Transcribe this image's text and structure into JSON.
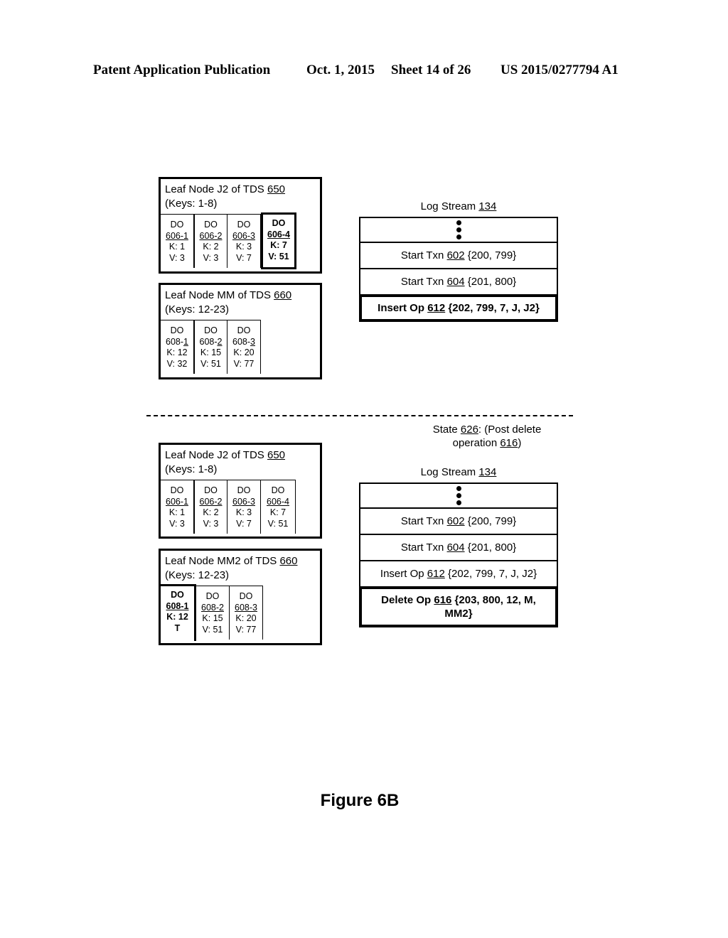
{
  "header": {
    "publication": "Patent Application Publication",
    "date": "Oct. 1, 2015",
    "sheet": "Sheet 14 of 26",
    "number": "US 2015/0277794 A1"
  },
  "top": {
    "leaf_j2": {
      "title_pre": "Leaf Node J2 of TDS ",
      "title_ref": "650",
      "keys": "(Keys: 1-8)",
      "cells": [
        {
          "l1": "DO",
          "ref": "606-1",
          "k": "K: 1",
          "v": "V: 3"
        },
        {
          "l1": "DO",
          "ref": "606-2",
          "k": "K: 2",
          "v": "V: 3"
        },
        {
          "l1": "DO",
          "ref": "606-3",
          "k": "K: 3",
          "v": "V: 7"
        },
        {
          "l1": "DO",
          "ref": "606-4",
          "k": "K: 7",
          "v": "V: 51",
          "highlight": true
        }
      ]
    },
    "leaf_mm": {
      "title_pre": "Leaf Node MM of TDS ",
      "title_ref": "660",
      "keys": "(Keys: 12-23)",
      "cells": [
        {
          "l1": "DO",
          "ref_pre": "608-",
          "ref_u": "1",
          "k": "K: 12",
          "v": "V: 32"
        },
        {
          "l1": "DO",
          "ref_pre": "608-",
          "ref_u": "2",
          "k": "K: 15",
          "v": "V: 51"
        },
        {
          "l1": "DO",
          "ref_pre": "608-",
          "ref_u": "3",
          "k": "K: 20",
          "v": "V: 77"
        }
      ]
    },
    "log": {
      "title_pre": "Log Stream ",
      "title_ref": "134",
      "rows": [
        {
          "pre": "Start Txn ",
          "ref": "602",
          "post": " {200, 799}"
        },
        {
          "pre": "Start Txn ",
          "ref": "604",
          "post": " {201, 800}"
        },
        {
          "pre": "Insert Op ",
          "ref": "612",
          "post": " {202, 799, 7, J, J2}",
          "highlight": true
        }
      ]
    }
  },
  "state": {
    "pre": "State ",
    "ref": "626",
    "mid": ": (Post delete operation ",
    "ref2": "616",
    "post": ")"
  },
  "bottom": {
    "leaf_j2": {
      "title_pre": "Leaf Node J2 of TDS ",
      "title_ref": "650",
      "keys": "(Keys: 1-8)",
      "cells": [
        {
          "l1": "DO",
          "ref": "606-1",
          "k": "K: 1",
          "v": "V: 3"
        },
        {
          "l1": "DO",
          "ref": "606-2",
          "k": "K: 2",
          "v": "V: 3"
        },
        {
          "l1": "DO",
          "ref": "606-3",
          "k": "K: 3",
          "v": "V: 7"
        },
        {
          "l1": "DO",
          "ref": "606-4",
          "k": "K: 7",
          "v": "V: 51"
        }
      ]
    },
    "leaf_mm2": {
      "title_pre": "Leaf Node MM2 of TDS ",
      "title_ref": "660",
      "keys": "(Keys: 12-23)",
      "cells": [
        {
          "l1": "DO",
          "ref": "608-1",
          "k": "K: 12",
          "v": "T",
          "highlight": true
        },
        {
          "l1": "DO",
          "ref": "608-2",
          "k": "K: 15",
          "v": "V: 51"
        },
        {
          "l1": "DO",
          "ref": "608-3",
          "k": "K: 20",
          "v": "V: 77"
        }
      ]
    },
    "log": {
      "title_pre": "Log Stream ",
      "title_ref": "134",
      "rows": [
        {
          "pre": "Start Txn ",
          "ref": "602",
          "post": " {200, 799}"
        },
        {
          "pre": "Start Txn ",
          "ref": "604",
          "post": " {201, 800}"
        },
        {
          "pre": "Insert Op ",
          "ref": "612",
          "post": " {202, 799, 7, J, J2}"
        },
        {
          "pre": "Delete Op ",
          "ref": "616",
          "post": " {203, 800, 12, M, MM2}",
          "highlight": true
        }
      ]
    }
  },
  "figure_label": "Figure 6B"
}
